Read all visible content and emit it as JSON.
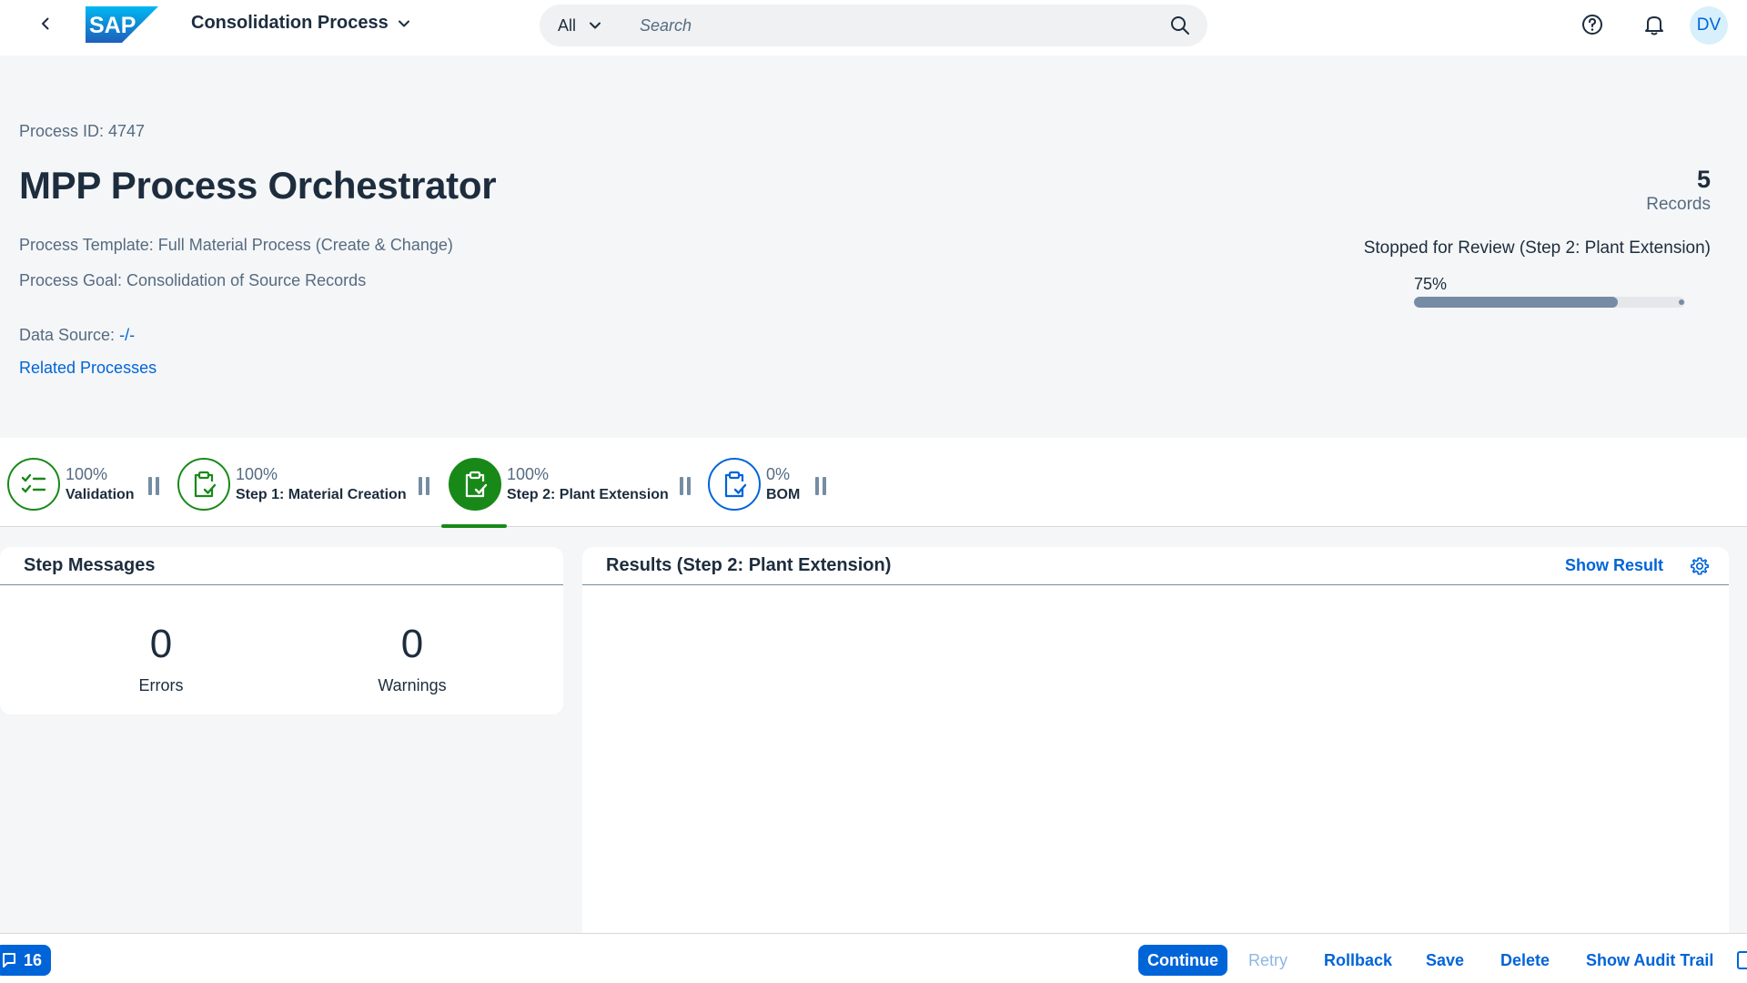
{
  "shell": {
    "title": "Consolidation Process",
    "logo_text": "SAP",
    "search_scope": "All",
    "search_placeholder": "Search",
    "avatar_initials": "DV"
  },
  "header": {
    "process_id": "Process ID: 4747",
    "title": "MPP Process Orchestrator",
    "template_label": "Process Template: Full Material Process (Create & Change)",
    "goal_label": "Process Goal: Consolidation of Source Records",
    "data_source_label": "Data Source:",
    "data_source_value": "-/-",
    "related_processes": "Related Processes",
    "records_count": "5",
    "records_label": "Records",
    "status": "Stopped for Review (Step 2: Plant Extension)",
    "progress_label": "75%",
    "progress_value": 0.75
  },
  "steps": [
    {
      "percent": "100%",
      "label": "Validation",
      "icon": "checklist-icon",
      "state": "done"
    },
    {
      "percent": "100%",
      "label": "Step 1: Material Creation",
      "icon": "clipboard-check-icon",
      "state": "done"
    },
    {
      "percent": "100%",
      "label": "Step 2: Plant Extension",
      "icon": "clipboard-check-icon",
      "state": "selected"
    },
    {
      "percent": "0%",
      "label": "BOM",
      "icon": "clipboard-check-icon",
      "state": "pending"
    }
  ],
  "step_messages": {
    "title": "Step Messages",
    "errors_count": "0",
    "errors_label": "Errors",
    "warnings_count": "0",
    "warnings_label": "Warnings"
  },
  "results": {
    "title": "Results (Step 2: Plant Extension)",
    "show_result": "Show Result"
  },
  "footer": {
    "messages_count": "16",
    "continue": "Continue",
    "retry": "Retry",
    "rollback": "Rollback",
    "save": "Save",
    "delete": "Delete",
    "show_audit_trail": "Show Audit Trail"
  },
  "colors": {
    "brand": "#0064d9",
    "success": "#188918",
    "progress": "#758ca4"
  }
}
